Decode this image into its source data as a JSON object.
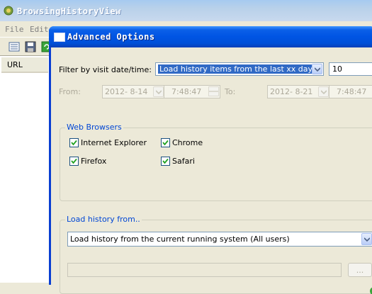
{
  "main_window": {
    "title": "BrowsingHistoryView",
    "menu": [
      "File",
      "Edit"
    ],
    "list_column": "URL"
  },
  "dialog": {
    "title": "Advanced Options",
    "filter_label": "Filter by visit date/time:",
    "filter_selected": "Load history items from the last xx days",
    "days_value": "10",
    "from_label": "From:",
    "from_date": "2012- 8-14",
    "from_time": "7:48:47",
    "to_label": "To:",
    "to_date": "2012- 8-21",
    "to_time": "7:48:47",
    "web_browsers": {
      "title": "Web Browsers",
      "items": [
        {
          "label": "Internet Explorer",
          "checked": true
        },
        {
          "label": "Chrome",
          "checked": true
        },
        {
          "label": "Firefox",
          "checked": true
        },
        {
          "label": "Safari",
          "checked": true
        }
      ]
    },
    "load_from": {
      "title": "Load history from..",
      "selected": "Load history from the current running system (All users)",
      "path_value": "",
      "browse_label": "..."
    }
  },
  "colors": {
    "title_bar": "#0054e3",
    "group_title": "#0046d5",
    "selection": "#316ac5",
    "dialog_bg": "#ece9d8"
  }
}
